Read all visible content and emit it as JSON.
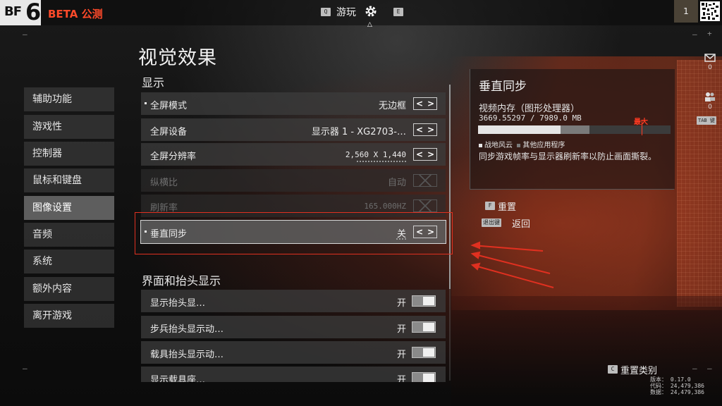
{
  "topbar": {
    "logo_bf": "BF",
    "logo_six": "6",
    "beta_label": "BETA 公测",
    "game_key": "Q",
    "game_label": "游玩",
    "settings_key": "E",
    "level": "1"
  },
  "page_title": "视觉效果",
  "nav": [
    {
      "label": "辅助功能"
    },
    {
      "label": "游戏性"
    },
    {
      "label": "控制器"
    },
    {
      "label": "鼠标和键盘"
    },
    {
      "label": "图像设置",
      "active": true
    },
    {
      "label": "音频"
    },
    {
      "label": "系统"
    },
    {
      "label": "额外内容"
    },
    {
      "label": "离开游戏"
    }
  ],
  "sections": {
    "display_title": "显示",
    "hud_title": "界面和抬头显示"
  },
  "display_rows": [
    {
      "label": "全屏模式",
      "value": "无边框",
      "state": "normal"
    },
    {
      "label": "全屏设备",
      "value": "显示器 1 - XG2703-…",
      "state": "normal"
    },
    {
      "label": "全屏分辨率",
      "value": "2,560 X 1,440",
      "state": "normal"
    },
    {
      "label": "纵横比",
      "value": "自动",
      "state": "disabled"
    },
    {
      "label": "刷新率",
      "value": "165.000HZ",
      "state": "disabled"
    },
    {
      "label": "垂直同步",
      "value": "关",
      "state": "selected"
    }
  ],
  "hud_rows": [
    {
      "label": "显示抬头显…",
      "value": "开",
      "toggle": true
    },
    {
      "label": "步兵抬头显示动…",
      "value": "开",
      "toggle": true
    },
    {
      "label": "载具抬头显示动…",
      "value": "开",
      "toggle": true
    },
    {
      "label": "显示载具座…",
      "value": "开",
      "toggle": true
    }
  ],
  "detail": {
    "title": "垂直同步",
    "memory_label": "视频内存（图形处理器）",
    "memory_used": "3669.55297 / 7989.0 MB",
    "max_label": "最大",
    "app_usage_fraction": 0.43,
    "other_usage_fraction": 0.15,
    "max_fraction": 0.85,
    "legend_app": "战地风云",
    "legend_other": "其他应用程序",
    "description": "同步游戏帧率与显示器刷新率以防止画面撕裂。",
    "reset_key": "F",
    "reset_label": "重置",
    "back_key": "退出键",
    "back_label": "返回"
  },
  "side": {
    "mail_count": "0",
    "friends_count": "0",
    "tab_label": "TAB 键"
  },
  "footer": {
    "reset_category_key": "C",
    "reset_category": "重置类别",
    "version": "版本： 0.17.0",
    "code": "代码： 24,479,386",
    "data": "数据： 24,479,386"
  },
  "colors": {
    "accent_red": "#ff4a2a",
    "highlight_red": "#e03020"
  }
}
